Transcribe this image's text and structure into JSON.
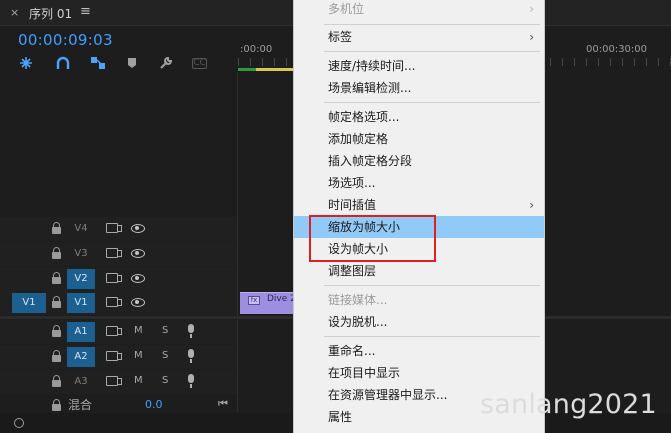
{
  "panel": {
    "close_label": "×",
    "sequence_title": "序列 01",
    "panel_menu_glyph": "≡"
  },
  "timecode": "00:00:09:03",
  "tools": [
    {
      "name": "nest-or-insert-icon"
    },
    {
      "name": "snap-icon"
    },
    {
      "name": "linked-selection-icon"
    },
    {
      "name": "add-marker-icon"
    },
    {
      "name": "wrench-icon"
    },
    {
      "name": "captions-icon",
      "label": "CC"
    }
  ],
  "ruler": {
    "start_label": ":00:00",
    "end_label": "00:00:30:00"
  },
  "video_tracks": [
    {
      "id": "V4",
      "targeted": false
    },
    {
      "id": "V3",
      "targeted": false
    },
    {
      "id": "V2",
      "targeted": true
    },
    {
      "id": "V1",
      "targeted": true,
      "source_patch": "V1"
    }
  ],
  "audio_tracks": [
    {
      "id": "A1",
      "mute": "M",
      "solo": "S"
    },
    {
      "id": "A2",
      "mute": "M",
      "solo": "S"
    },
    {
      "id": "A3",
      "mute": "M",
      "solo": "S"
    }
  ],
  "mix": {
    "label": "混合",
    "value": "0.0"
  },
  "clip": {
    "fx_badge": "fx",
    "label": "Dive 2"
  },
  "context_menu": {
    "items": [
      {
        "label": "多机位",
        "disabled": true,
        "submenu": true
      },
      {
        "label": "标签",
        "submenu": true
      },
      {
        "label": "速度/持续时间..."
      },
      {
        "label": "场景编辑检测..."
      },
      {
        "label": "帧定格选项..."
      },
      {
        "label": "添加帧定格"
      },
      {
        "label": "插入帧定格分段"
      },
      {
        "label": "场选项..."
      },
      {
        "label": "时间插值",
        "submenu": true
      },
      {
        "label": "缩放为帧大小",
        "highlighted": true
      },
      {
        "label": "设为帧大小"
      },
      {
        "label": "调整图层"
      },
      {
        "label": "链接媒体...",
        "disabled": true
      },
      {
        "label": "设为脱机..."
      },
      {
        "label": "重命名..."
      },
      {
        "label": "在项目中显示"
      },
      {
        "label": "在资源管理器中显示..."
      },
      {
        "label": "属性"
      }
    ],
    "submenu_arrow": "›"
  },
  "watermark": "sanlang2021",
  "colors": {
    "accent_blue": "#3ea1ff",
    "highlight": "#91c9f7",
    "annotation_red": "#e02020",
    "clip_purple": "#9d8ee0",
    "work_area_yellow": "#d6c84a"
  }
}
